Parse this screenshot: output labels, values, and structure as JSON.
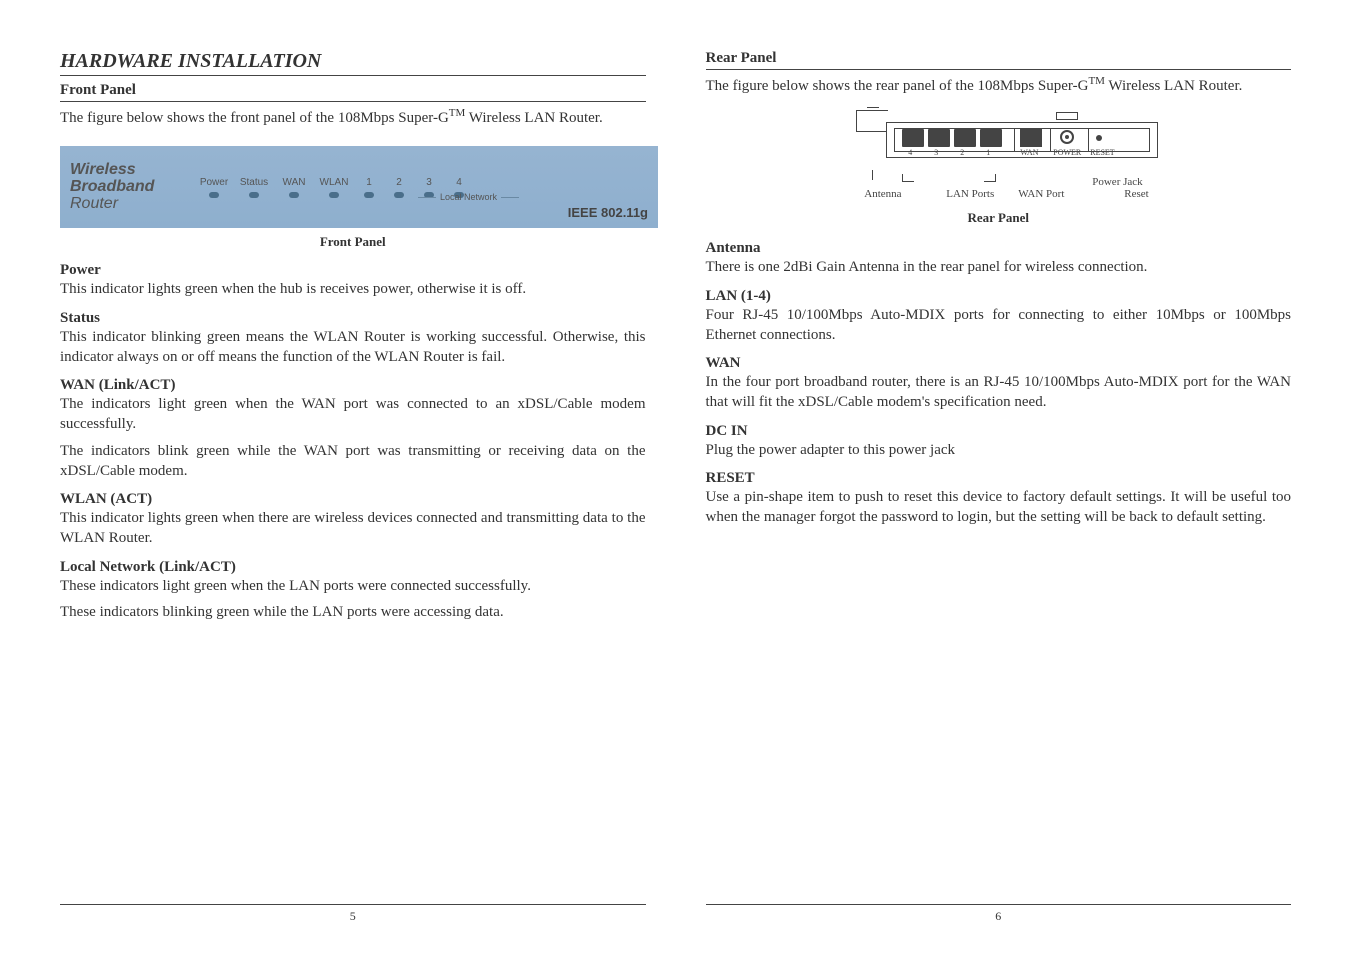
{
  "left": {
    "heading": "HARDWARE INSTALLATION",
    "front_panel_heading": "Front Panel",
    "front_panel_intro_a": "The figure below shows the front panel of the 108Mbps Super-G",
    "front_panel_intro_tm": "TM",
    "front_panel_intro_b": " Wireless LAN Router.",
    "figure": {
      "brand1": "Wireless",
      "brand2": "Broadband",
      "brand3": "Router",
      "leds": [
        "Power",
        "Status",
        "WAN",
        "WLAN",
        "1",
        "2",
        "3",
        "4"
      ],
      "local_network": "Local Network",
      "ieee": "IEEE 802.11g",
      "caption": "Front Panel"
    },
    "sections": [
      {
        "title": "Power",
        "body": "This indicator lights green when the hub is receives power, otherwise it is off."
      },
      {
        "title": "Status",
        "body": "This indicator blinking green means the WLAN Router is working successful. Otherwise, this indicator always on or off means the function of the WLAN Router is fail."
      },
      {
        "title": "WAN (Link/ACT)",
        "body": "The indicators light green when the WAN port was connected to an xDSL/Cable modem successfully."
      },
      {
        "title": "",
        "body": "The indicators blink green while the WAN port was transmitting or receiving data on the xDSL/Cable modem."
      },
      {
        "title": "WLAN (ACT)",
        "body": "This indicator lights green when there are wireless devices connected and transmitting data to the WLAN Router."
      },
      {
        "title": "Local Network (Link/ACT)",
        "body": "These indicators light green when the LAN ports were connected successfully."
      },
      {
        "title": "",
        "body": "These indicators blinking green while the LAN ports were accessing data."
      }
    ],
    "page_no": "5"
  },
  "right": {
    "rear_panel_heading": "Rear Panel",
    "rear_panel_intro_a": "The figure below shows the rear panel of the 108Mbps Super-G",
    "rear_panel_intro_tm": "TM",
    "rear_panel_intro_b": " Wireless LAN Router.",
    "figure": {
      "port_numbers": [
        "4",
        "3",
        "2",
        "1"
      ],
      "wan_tiny": "WAN",
      "power_tiny": "POWER",
      "reset_tiny": "RESET",
      "antenna_label": "Antenna",
      "lan_ports_label": "LAN Ports",
      "wan_port_label": "WAN Port",
      "power_jack_label": "Power Jack",
      "reset_label": "Reset",
      "caption": "Rear Panel"
    },
    "sections": [
      {
        "title": "Antenna",
        "body": "There is one 2dBi Gain Antenna in the rear panel for wireless connection."
      },
      {
        "title": "LAN (1-4)",
        "body": "Four RJ-45 10/100Mbps Auto-MDIX ports for connecting to either 10Mbps or 100Mbps Ethernet connections."
      },
      {
        "title": "WAN",
        "body": "In the four port broadband router, there is an RJ-45 10/100Mbps Auto-MDIX port for the WAN that will fit the xDSL/Cable modem's specification need."
      },
      {
        "title": "DC IN",
        "body": "Plug the power adapter to this power jack"
      },
      {
        "title": "RESET",
        "body": "Use a pin-shape item to push to reset this device to factory default settings. It will be useful too when the manager forgot the password to login, but the setting will be back to default setting."
      }
    ],
    "page_no": "6"
  }
}
